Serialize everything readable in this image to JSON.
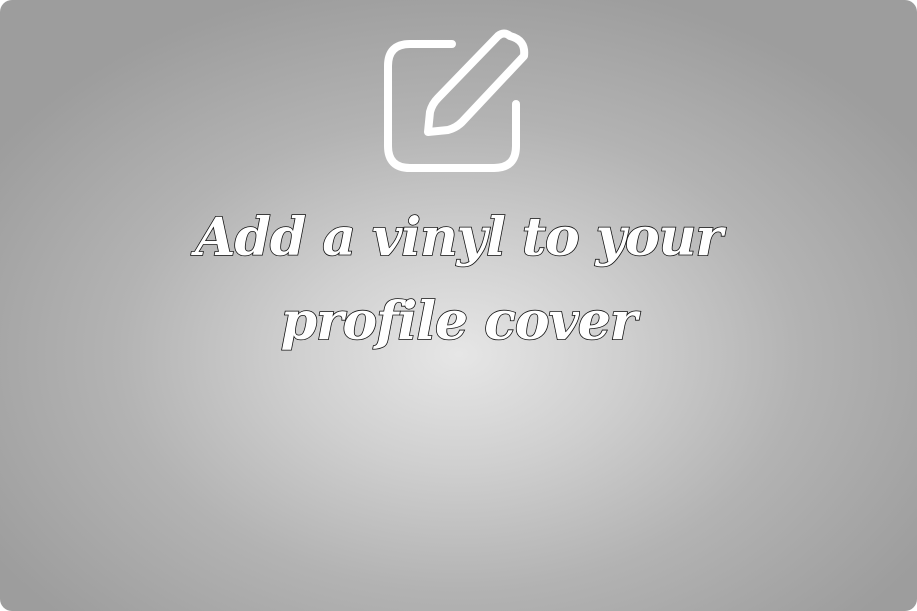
{
  "cover_placeholder": {
    "icon": "edit-icon",
    "prompt": "Add a vinyl to your profile cover"
  }
}
